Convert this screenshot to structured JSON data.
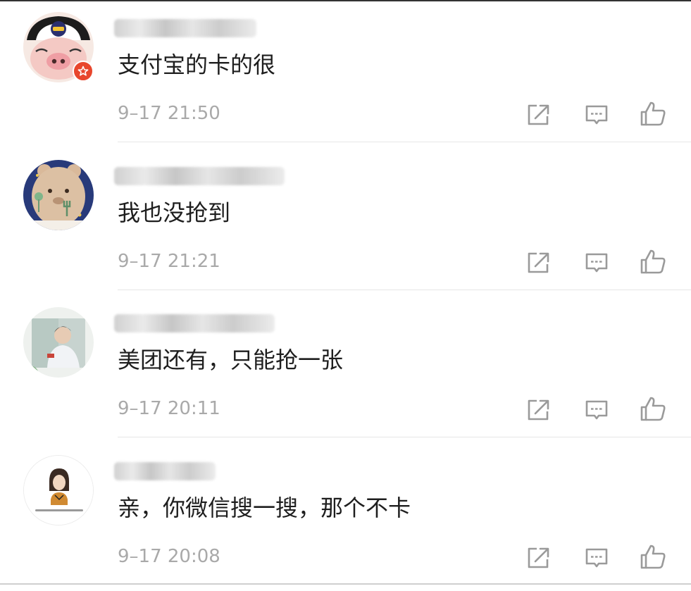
{
  "comments": [
    {
      "avatar": "cartoon-pig-avatar",
      "text": "支付宝的卡的很",
      "time": "9–17 21:50",
      "verified": true
    },
    {
      "avatar": "bear-avatar",
      "text": "我也没抢到",
      "time": "9–17 21:21",
      "verified": false
    },
    {
      "avatar": "person-photo-avatar",
      "text": "美团还有，只能抢一张",
      "time": "9–17 20:11",
      "verified": false
    },
    {
      "avatar": "drawn-girl-avatar",
      "text": "亲，你微信搜一搜，那个不卡",
      "time": "9–17 20:08",
      "verified": false
    }
  ],
  "actions": {
    "share_icon": "share-icon",
    "reply_icon": "comment-icon",
    "like_icon": "thumbs-up-icon"
  },
  "colors": {
    "text": "#1e1e1e",
    "timestamp": "#a9a9a9",
    "icon": "#9a9a9a",
    "divider": "#e6e6e6",
    "verified_badge": "#e8462c"
  }
}
